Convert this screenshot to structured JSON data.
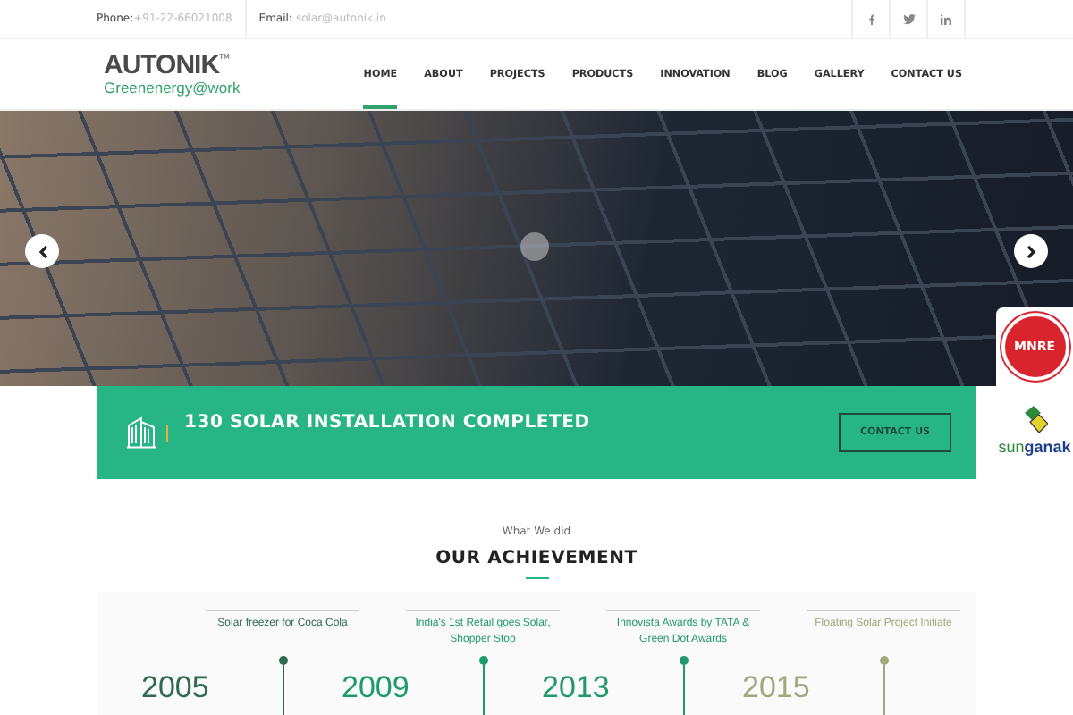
{
  "top_bar": {
    "phone_label": "Phone:",
    "phone": "+91-22-66021008",
    "email_label": "Email:",
    "email": "solar@autonik.in"
  },
  "logo": {
    "name": "AUTONIK",
    "trademark": "TM",
    "tagline": "Greenenergy@work"
  },
  "nav": [
    {
      "label": "HOME",
      "selected": true
    },
    {
      "label": "ABOUT",
      "selected": false
    },
    {
      "label": "PROJECTS",
      "selected": false
    },
    {
      "label": "PRODUCTS",
      "selected": false
    },
    {
      "label": "INNOVATION",
      "selected": false
    },
    {
      "label": "BLOG",
      "selected": false
    },
    {
      "label": "GALLERY",
      "selected": false
    },
    {
      "label": "CONTACT US",
      "selected": false
    }
  ],
  "banner": {
    "text": "130 SOLAR INSTALLATION COMPLETED",
    "button": "CONTACT US"
  },
  "partners": {
    "mnre": "MNRE",
    "sunganak": "sun**ganak**"
  },
  "section": {
    "subtitle": "What We did",
    "title": "OUR ACHIEVEMENT"
  },
  "timeline": [
    {
      "year": "2005",
      "event": "Solar freezer for Coca Cola",
      "color": "#2e6b4f"
    },
    {
      "year": "2009",
      "event": "India's 1st Retail goes Solar, Shopper Stop",
      "color": "#1f9b6b"
    },
    {
      "year": "2013",
      "event": "Innovista Awards by TATA & Green Dot Awards",
      "color": "#22996a"
    },
    {
      "year": "2015",
      "event": "Floating Solar Project Initiate",
      "color": "#a3a77a"
    }
  ]
}
